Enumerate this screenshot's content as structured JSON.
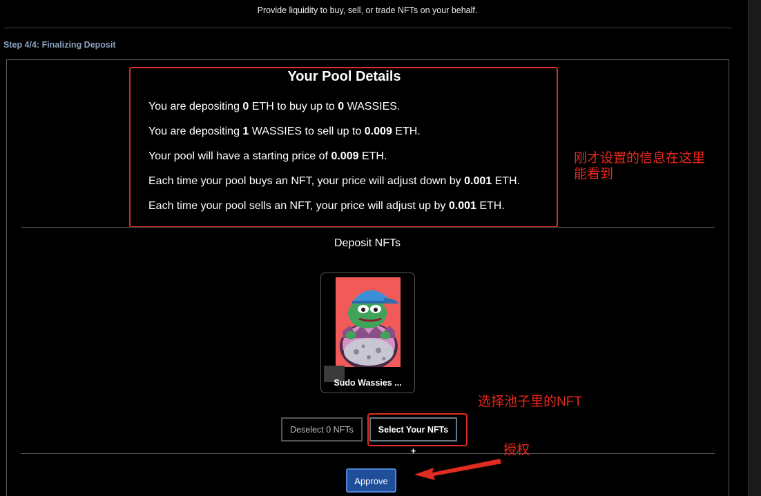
{
  "header": {
    "subtitle": "Provide liquidity to buy, sell, or trade NFTs on your behalf."
  },
  "step": {
    "label": "Step 4/4: Finalizing Deposit"
  },
  "pool_details": {
    "title": "Your Pool Details",
    "lines": [
      {
        "pre": "You are depositing ",
        "b1": "0",
        "mid": " ETH to buy up to ",
        "b2": "0",
        "post": " WASSIES."
      },
      {
        "pre": "You are depositing ",
        "b1": "1",
        "mid": " WASSIES to sell up to ",
        "b2": "0.009",
        "post": " ETH."
      },
      {
        "pre": "Your pool will have a starting price of ",
        "b1": "0.009",
        "post": " ETH."
      },
      {
        "pre": "Each time your pool buys an NFT, your price will adjust down by ",
        "b1": "0.001",
        "post": " ETH."
      },
      {
        "pre": "Each time your pool sells an NFT, your price will adjust up by ",
        "b1": "0.001",
        "post": " ETH."
      }
    ]
  },
  "deposit": {
    "title": "Deposit NFTs",
    "nft": {
      "name": "Sudo Wassies ..."
    },
    "deselect_label": "Deselect 0 NFTs",
    "select_label": "Select Your NFTs +"
  },
  "actions": {
    "approve_label": "Approve"
  },
  "annotations": {
    "details_note_line1": "刚才设置的信息在这里",
    "details_note_line2": "能看到",
    "select_note": "选择池子里的NFT",
    "approve_note": "授权"
  },
  "colors": {
    "background": "#000000",
    "annotation_red": "#e02b20",
    "step_label": "#8aa3bf",
    "approve_bg": "#1f4f9a",
    "approve_border": "#4f86d8"
  }
}
